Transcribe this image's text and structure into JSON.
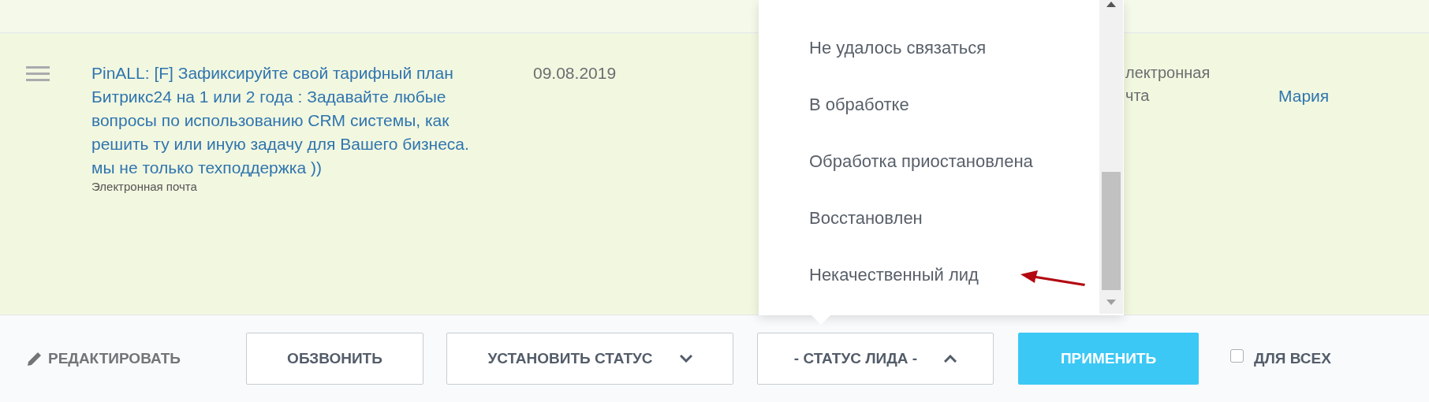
{
  "table": {
    "rows": [
      {
        "title": "PinALL: [F] Зафиксируйте свой тарифный план Битрикс24 на 1 или 2 года : Задавайте любые вопросы по использованию CRM системы, как решить ту или иную задачу для Вашего бизнеса. мы не только техподдержка ))",
        "source": "Электронная почта",
        "date": "09.08.2019",
        "column_4": [
          "лектронная",
          "чта"
        ],
        "responsible": "Мария"
      }
    ]
  },
  "dropdown": {
    "items": [
      {
        "label": "Не удалось связаться"
      },
      {
        "label": "В обработке"
      },
      {
        "label": "Обработка приостановлена"
      },
      {
        "label": "Восстановлен"
      },
      {
        "label": "Некачественный лид"
      }
    ]
  },
  "toolbar": {
    "edit": "РЕДАКТИРОВАТЬ",
    "buttons": [
      {
        "label": "ОБЗВОНИТЬ",
        "kind": "plain"
      },
      {
        "label": "УСТАНОВИТЬ СТАТУС",
        "kind": "dropdown",
        "expanded": false
      },
      {
        "label": "- СТАТУС ЛИДА -",
        "kind": "dropdown",
        "expanded": true
      },
      {
        "label": "ПРИМЕНИТЬ",
        "kind": "primary"
      }
    ],
    "for_all": {
      "label": "ДЛЯ ВСЕХ",
      "checked": false
    }
  }
}
